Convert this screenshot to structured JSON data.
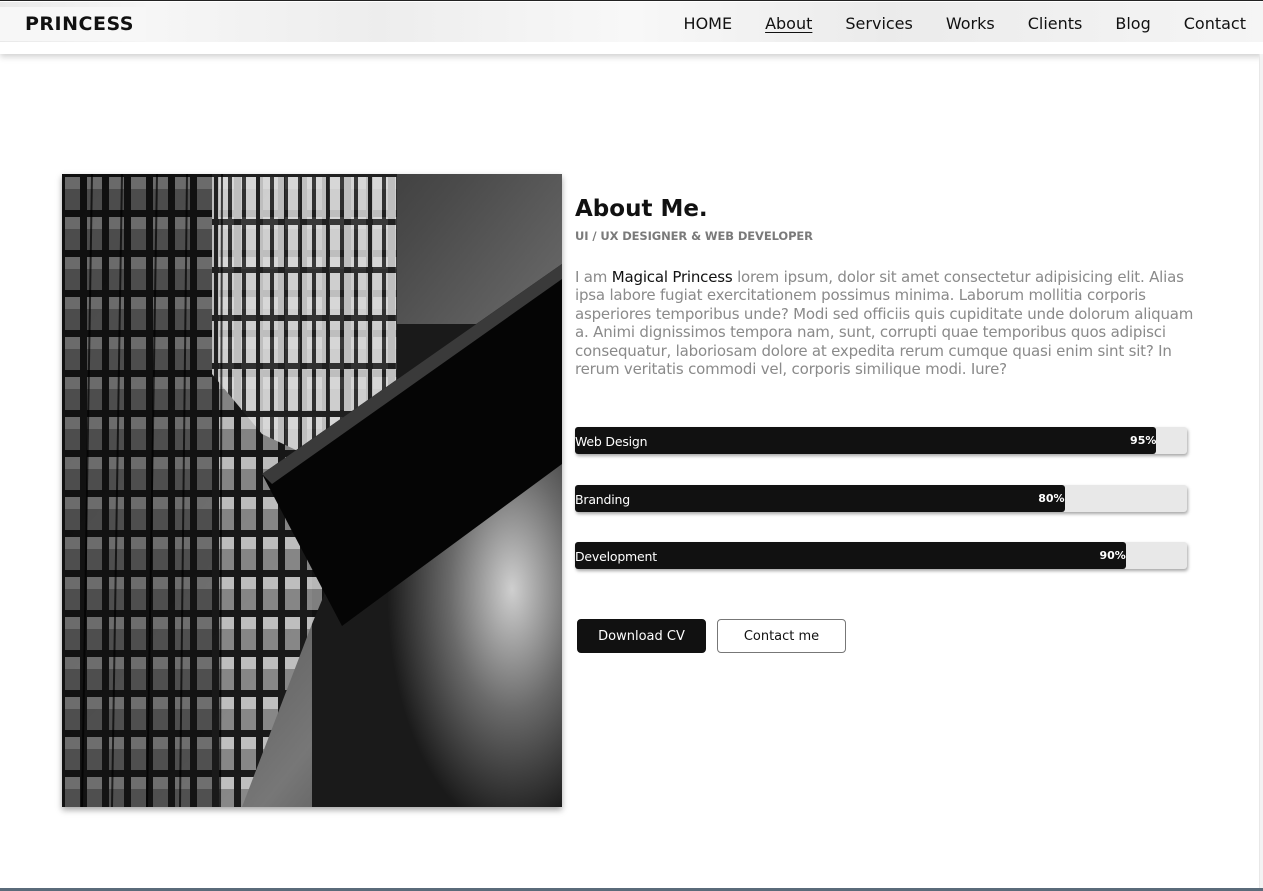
{
  "header": {
    "logo": "PRINCESS",
    "nav": [
      {
        "label": "HOME",
        "active": false
      },
      {
        "label": "About",
        "active": true
      },
      {
        "label": "Services",
        "active": false
      },
      {
        "label": "Works",
        "active": false
      },
      {
        "label": "Clients",
        "active": false
      },
      {
        "label": "Blog",
        "active": false
      },
      {
        "label": "Contact",
        "active": false
      }
    ]
  },
  "about": {
    "title": "About Me.",
    "subtitle": "UI / UX DESIGNER & WEB DEVELOPER",
    "intro_prefix": "I am ",
    "name": "Magical Princess",
    "body": " lorem ipsum, dolor sit amet consectetur adipisicing elit. Alias ipsa labore fugiat exercitationem possimus minima. Laborum mollitia corporis asperiores temporibus unde? Modi sed officiis quis cupiditate unde dolorum aliquam a. Animi dignissimos tempora nam, sunt, corrupti quae temporibus quos adipisci consequatur, laboriosam dolore at expedita rerum cumque quasi enim sint sit? In rerum veritatis commodi vel, corporis similique modi. Iure?"
  },
  "skills": [
    {
      "label": "Web Design",
      "percent_text": "95%",
      "value": 0.95
    },
    {
      "label": "Branding",
      "percent_text": "80%",
      "value": 0.8
    },
    {
      "label": "Development",
      "percent_text": "90%",
      "value": 0.9
    }
  ],
  "buttons": {
    "download": "Download CV",
    "contact": "Contact me"
  },
  "image": {
    "description_icon": "building-photo"
  },
  "colors": {
    "accent": "#111111",
    "muted_text": "#8a8a8a",
    "track": "#e8e8e8"
  }
}
